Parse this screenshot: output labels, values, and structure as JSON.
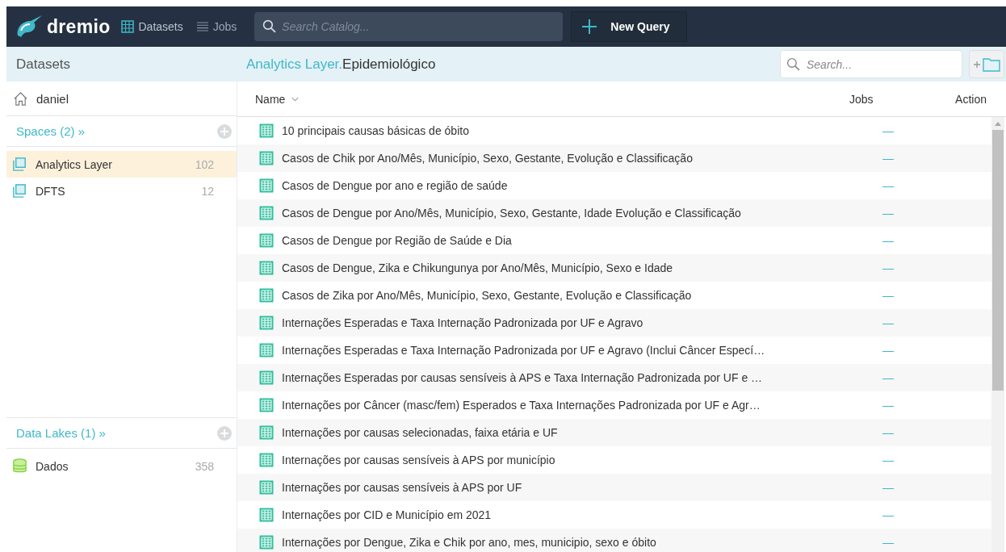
{
  "top_bar": {
    "logo": "dremio",
    "nav": [
      {
        "label": "Datasets",
        "kind": "grid",
        "selected": true
      },
      {
        "label": "Jobs",
        "kind": "list",
        "selected": false
      }
    ],
    "search": {
      "placeholder": "Search Catalog..."
    },
    "new_query": "New Query"
  },
  "sidebar": {
    "title": "Datasets",
    "home": "daniel",
    "spaces": {
      "title": "Spaces (2) »",
      "items": [
        {
          "name": "Analytics Layer",
          "count": "102",
          "selected": true
        },
        {
          "name": "DFTS",
          "count": "12",
          "selected": false
        }
      ]
    },
    "data_lakes": {
      "title": "Data Lakes (1) »",
      "items": [
        {
          "name": "Dados",
          "count": "358",
          "selected": false
        }
      ]
    }
  },
  "main": {
    "breadcrumb": {
      "parent": "Analytics Layer.",
      "current": "Epidemiológico"
    },
    "search": {
      "placeholder": "Search..."
    },
    "table": {
      "columns": [
        "Name",
        "Jobs",
        "Action"
      ],
      "rows": [
        {
          "name": "10 principais causas básicas de óbito",
          "jobs": "—"
        },
        {
          "name": "Casos de Chik por Ano/Mês, Município, Sexo, Gestante, Evolução e Classificação",
          "jobs": "—"
        },
        {
          "name": "Casos de Dengue por ano e região de saúde",
          "jobs": "—"
        },
        {
          "name": "Casos de Dengue por Ano/Mês, Município, Sexo, Gestante, Idade Evolução e Classificação",
          "jobs": "—"
        },
        {
          "name": "Casos de Dengue por Região de Saúde e Dia",
          "jobs": "—"
        },
        {
          "name": "Casos de Dengue, Zika e Chikungunya por Ano/Mês, Município, Sexo e Idade",
          "jobs": "—"
        },
        {
          "name": "Casos de Zika por Ano/Mês, Município, Sexo, Gestante, Evolução e Classificação",
          "jobs": "—"
        },
        {
          "name": "Internações Esperadas e Taxa Internação Padronizada por UF e Agravo",
          "jobs": "—"
        },
        {
          "name": "Internações Esperadas e Taxa Internação Padronizada por UF e Agravo (Inclui Câncer Especí…",
          "jobs": "—"
        },
        {
          "name": "Internações Esperadas por causas sensíveis à APS e Taxa Internação Padronizada por UF e …",
          "jobs": "—"
        },
        {
          "name": "Internações por Câncer (masc/fem) Esperados e Taxa Internações Padronizada por UF e Agr…",
          "jobs": "—"
        },
        {
          "name": "Internações por causas selecionadas, faixa etária e UF",
          "jobs": "—"
        },
        {
          "name": "Internações por causas sensíveis à APS por município",
          "jobs": "—"
        },
        {
          "name": "Internações por causas sensíveis à APS por UF",
          "jobs": "—"
        },
        {
          "name": "Internações por CID e Município em 2021",
          "jobs": "—"
        },
        {
          "name": "Internações por Dengue, Zika e Chik por ano, mes, municipio, sexo e óbito",
          "jobs": "—"
        }
      ]
    }
  }
}
